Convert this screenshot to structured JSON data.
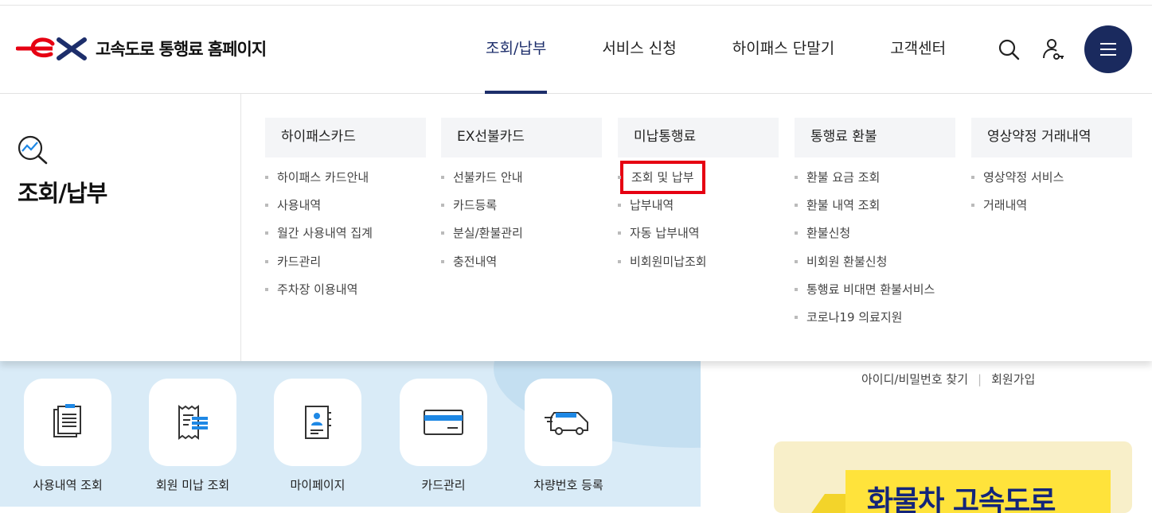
{
  "logo": {
    "text": "고속도로 통행료 홈페이지",
    "brand_color": "#e60012",
    "accent_color": "#1d2e6b"
  },
  "gnb": [
    {
      "label": "조회/납부",
      "active": true
    },
    {
      "label": "서비스 신청"
    },
    {
      "label": "하이패스 단말기"
    },
    {
      "label": "고객센터"
    }
  ],
  "util": {
    "search_icon": "search-icon",
    "user_icon": "user-key-icon",
    "menu_icon": "hamburger-icon"
  },
  "mega": {
    "side_title": "조회/납부",
    "side_icon": "chart-search-icon",
    "columns": [
      {
        "title": "하이패스카드",
        "items": [
          "하이패스 카드안내",
          "사용내역",
          "월간 사용내역 집계",
          "카드관리",
          "주차장 이용내역"
        ]
      },
      {
        "title": "EX선불카드",
        "items": [
          "선불카드 안내",
          "카드등록",
          "분실/환불관리",
          "충전내역"
        ]
      },
      {
        "title": "미납통행료",
        "items": [
          "조회 및 납부",
          "납부내역",
          "자동 납부내역",
          "비회원미납조회"
        ],
        "highlight_index": 0
      },
      {
        "title": "통행료 환불",
        "items": [
          "환불 요금 조회",
          "환불 내역 조회",
          "환불신청",
          "비회원 환불신청",
          "통행료 비대면 환불서비스",
          "코로나19 의료지원"
        ]
      },
      {
        "title": "영상약정 거래내역",
        "items": [
          "영상약정 서비스",
          "거래내역"
        ]
      }
    ]
  },
  "quick": [
    {
      "label": "사용내역 조회",
      "icon": "document-list-icon"
    },
    {
      "label": "회원 미납 조회",
      "icon": "receipt-icon"
    },
    {
      "label": "마이페이지",
      "icon": "profile-book-icon"
    },
    {
      "label": "카드관리",
      "icon": "card-icon"
    },
    {
      "label": "차량번호 등록",
      "icon": "truck-icon"
    }
  ],
  "account": {
    "find": "아이디/비밀번호 찾기",
    "join": "회원가입"
  },
  "banner": {
    "text": "화물차 고속도로"
  }
}
